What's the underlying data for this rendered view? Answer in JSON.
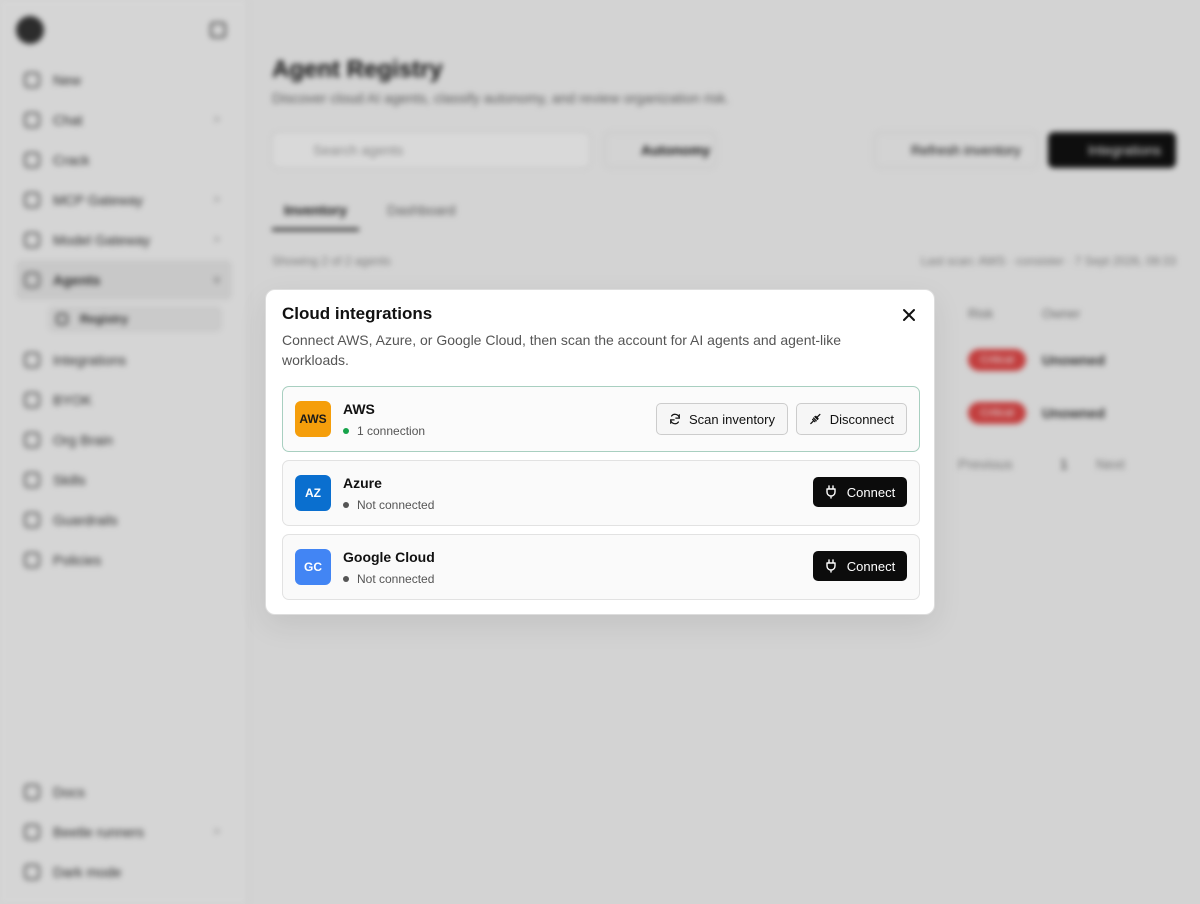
{
  "sidebar": {
    "items": [
      {
        "label": "New",
        "chevron": ""
      },
      {
        "label": "Chat",
        "chevron": ">"
      },
      {
        "label": "Crack",
        "chevron": ""
      },
      {
        "label": "MCP Gateway",
        "chevron": ">"
      },
      {
        "label": "Model Gateway",
        "chevron": ">"
      },
      {
        "label": "Agents",
        "chevron": "v"
      }
    ],
    "sub_item": "Registry",
    "items_after": [
      {
        "label": "Integrations"
      },
      {
        "label": "BYOK"
      },
      {
        "label": "Org Brain"
      },
      {
        "label": "Skills"
      },
      {
        "label": "Guardrails"
      },
      {
        "label": "Policies"
      }
    ],
    "bottom": [
      {
        "label": "Docs"
      },
      {
        "label": "Beetle runners",
        "chevron": ">"
      },
      {
        "label": "Dark mode"
      }
    ]
  },
  "main": {
    "title": "Agent Registry",
    "subtitle": "Discover cloud AI agents, classify autonomy, and review organization risk.",
    "search_placeholder": "Search agents",
    "filter_label": "Autonomy",
    "refresh_label": "Refresh inventory",
    "integrations_label": "Integrations",
    "tabs": [
      "Inventory",
      "Dashboard"
    ],
    "showing": "Showing 2 of 2 agents",
    "last_scan": "Last scan: AWS · consister · 7 Sept 2026, 09:33",
    "columns": [
      "Risk",
      "Owner"
    ],
    "rows": [
      {
        "risk": "Critical",
        "owner": "Unowned"
      },
      {
        "risk": "Critical",
        "owner": "Unowned"
      }
    ],
    "pager": {
      "prev": "Previous",
      "page": "1",
      "next": "Next"
    }
  },
  "modal": {
    "title": "Cloud integrations",
    "description": "Connect AWS, Azure, or Google Cloud, then scan the account for AI agents and agent-like workloads.",
    "providers": [
      {
        "badge": "AWS",
        "name": "AWS",
        "status": "1 connection",
        "badge_color": "#f59e0b",
        "badge_text_color": "#1a1a1a",
        "dot_color": "#16a34a"
      },
      {
        "badge": "AZ",
        "name": "Azure",
        "status": "Not connected",
        "badge_color": "#0a6fcf",
        "badge_text_color": "#ffffff",
        "dot_color": "#555555"
      },
      {
        "badge": "GC",
        "name": "Google Cloud",
        "status": "Not connected",
        "badge_color": "#4285f4",
        "badge_text_color": "#ffffff",
        "dot_color": "#555555"
      }
    ],
    "scan_label": "Scan inventory",
    "disconnect_label": "Disconnect",
    "connect_label": "Connect"
  }
}
